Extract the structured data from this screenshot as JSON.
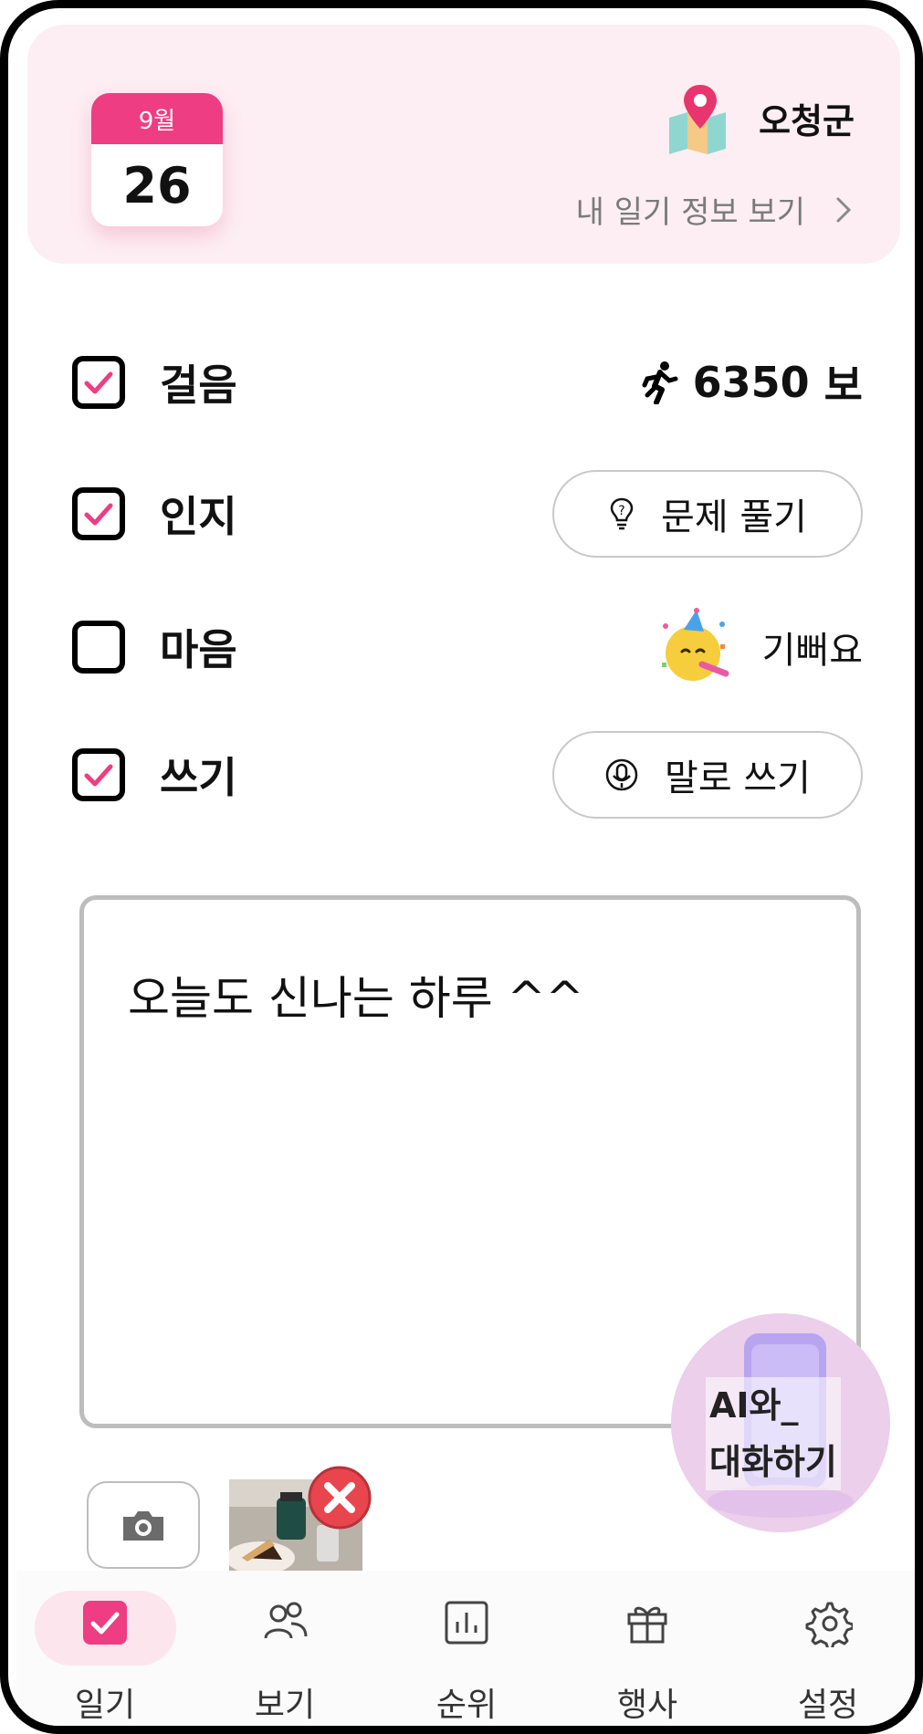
{
  "header": {
    "month": "9월",
    "day": "26",
    "location_name": "오청군",
    "diary_info_link": "내 일기 정보 보기"
  },
  "checklist": [
    {
      "label": "걸음",
      "checked": true
    },
    {
      "label": "인지",
      "checked": true
    },
    {
      "label": "마음",
      "checked": false
    },
    {
      "label": "쓰기",
      "checked": true
    }
  ],
  "steps": {
    "value": "6350",
    "unit": "보"
  },
  "buttons": {
    "solve_problem": "문제 풀기",
    "speak_write": "말로 쓰기"
  },
  "mood": {
    "label": "기뻐요",
    "icon": "party-face-icon"
  },
  "diary": {
    "text": "오늘도 신나는 하루 ^^"
  },
  "ai_chat": {
    "line1": "AI와_",
    "line2": "대화하기"
  },
  "nav": [
    {
      "label": "일기",
      "icon": "check-square-icon",
      "active": true
    },
    {
      "label": "보기",
      "icon": "people-icon",
      "active": false
    },
    {
      "label": "순위",
      "icon": "chart-icon",
      "active": false
    },
    {
      "label": "행사",
      "icon": "gift-icon",
      "active": false
    },
    {
      "label": "설정",
      "icon": "gear-icon",
      "active": false
    }
  ],
  "colors": {
    "accent": "#ee3d82",
    "header_bg": "#fdeef3",
    "ai_bubble": "#eccfeb"
  }
}
